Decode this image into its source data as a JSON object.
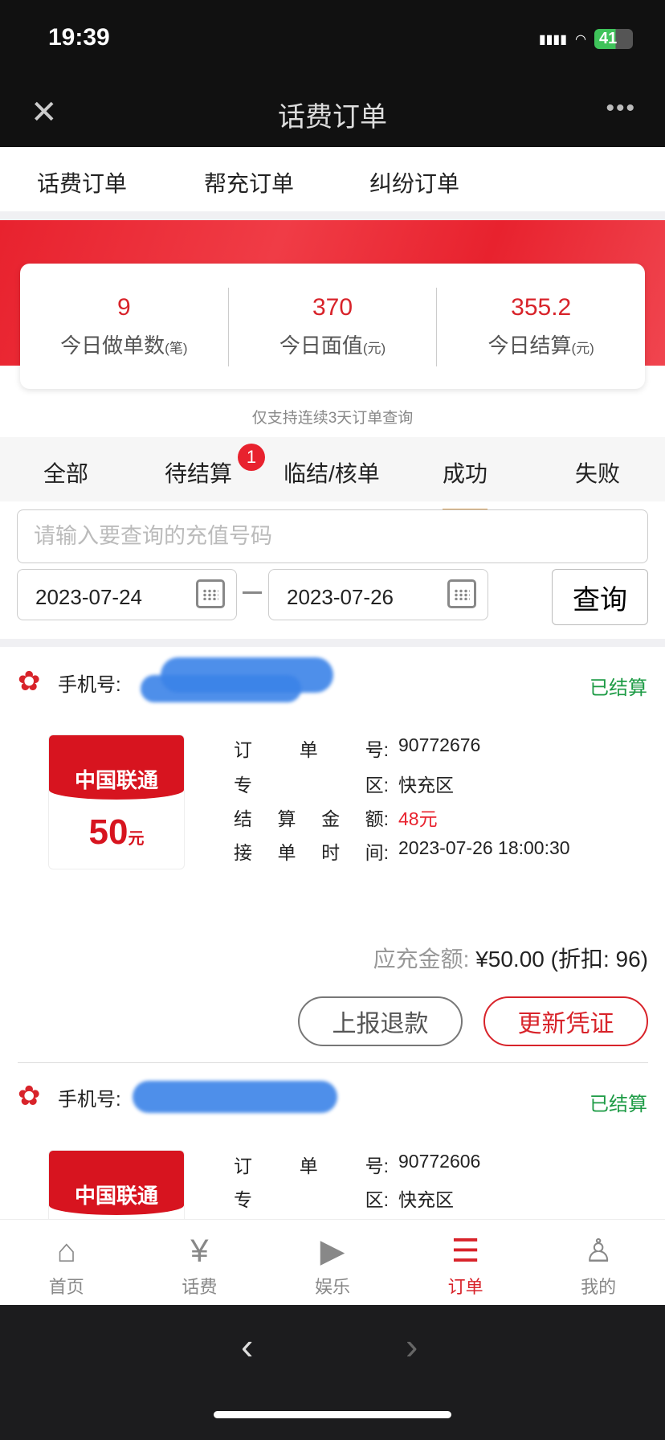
{
  "status_bar": {
    "time": "19:39",
    "battery": "41"
  },
  "header": {
    "title": "话费订单",
    "close_icon": "close-icon",
    "more_icon": "more-icon"
  },
  "top_tabs": [
    {
      "label": "话费订单",
      "active": true
    },
    {
      "label": "帮充订单"
    },
    {
      "label": "纠纷订单"
    }
  ],
  "stats": [
    {
      "value": "9",
      "label": "今日做单数",
      "unit": "(笔)"
    },
    {
      "value": "370",
      "label": "今日面值",
      "unit": "(元)"
    },
    {
      "value": "355.2",
      "label": "今日结算",
      "unit": "(元)"
    }
  ],
  "note": "仅支持连续3天订单查询",
  "status_tabs": [
    {
      "label": "全部"
    },
    {
      "label": "待结算",
      "badge": "1"
    },
    {
      "label": "临结/核单"
    },
    {
      "label": "成功",
      "active": true
    },
    {
      "label": "失败"
    }
  ],
  "search": {
    "placeholder": "请输入要查询的充值号码",
    "value": ""
  },
  "dates": {
    "start": "2023-07-24",
    "end": "2023-07-26",
    "query_label": "查询"
  },
  "orders": [
    {
      "phone_label": "手机号:",
      "status": "已结算",
      "card_brand": "中国联通",
      "card_amount": "50",
      "card_unit": "元",
      "rows": [
        {
          "label": [
            "订",
            "单",
            "号:"
          ],
          "value": "90772676"
        },
        {
          "label": [
            "专",
            "区:"
          ],
          "value": "快充区"
        },
        {
          "label": [
            "结",
            "算",
            "金",
            "额:"
          ],
          "value": "48元"
        },
        {
          "label": [
            "接",
            "单",
            "时",
            "间:"
          ],
          "value": "2023-07-26 18:00:30"
        }
      ],
      "pay_label": "应充金额:",
      "pay_value": "¥50.00 (折扣: 96)",
      "refund_label": "上报退款",
      "update_label": "更新凭证"
    },
    {
      "phone_label": "手机号:",
      "status": "已结算",
      "card_brand": "中国联通",
      "rows": [
        {
          "label": [
            "订",
            "单",
            "号:"
          ],
          "value": "90772606"
        },
        {
          "label": [
            "专",
            "区:"
          ],
          "value": "快充区"
        }
      ]
    }
  ],
  "bottom_nav": [
    {
      "label": "首页",
      "icon": "home-icon"
    },
    {
      "label": "话费",
      "icon": "phone-bill-icon"
    },
    {
      "label": "娱乐",
      "icon": "video-icon"
    },
    {
      "label": "订单",
      "icon": "order-icon",
      "active": true
    },
    {
      "label": "我的",
      "icon": "user-icon"
    }
  ],
  "colors": {
    "accent": "#d8232a",
    "tab_underline": "#d39b52",
    "settled": "#1d9b45"
  }
}
